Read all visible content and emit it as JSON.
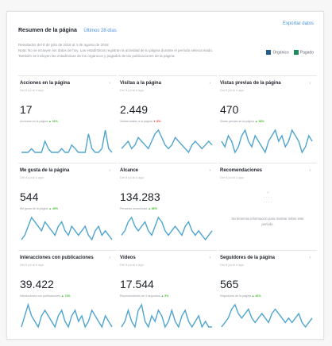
{
  "header": {
    "title": "Resumen de la página",
    "range_label": "Últimos 28 días",
    "export_label": "Exportar datos"
  },
  "meta_lines": [
    "Resultados del 8 de julio de 2018 al 4 de agosto de 2018",
    "Nota: No se incluyen los datos de hoy. Las estadísticas registran la actividad de tu página durante el período seleccionado.",
    "También se incluyen las estadísticas de los orgánicos y pagados de las publicaciones de la página."
  ],
  "legend": [
    {
      "label": "Orgánico",
      "color": "#1e5f8e"
    },
    {
      "label": "Pagado",
      "color": "#1f8b5f"
    }
  ],
  "colors": {
    "line": "#4fa5cf",
    "up": "#42b72a",
    "down": "#e63b3b",
    "link": "#4a90e2"
  },
  "cards": [
    {
      "title": "Acciones en la página",
      "subtitle": "Del 8 jul al 4 ago",
      "value": "17",
      "compare": "Acciones en la página",
      "pct": "▲ 31%",
      "trend": "up",
      "series": [
        2,
        2,
        2,
        3,
        2,
        2,
        2,
        5,
        3,
        2,
        2,
        2,
        3,
        2,
        2,
        4,
        3,
        2,
        2,
        2,
        7,
        3,
        2,
        2,
        3,
        8,
        3,
        2
      ]
    },
    {
      "title": "Visitas a la página",
      "subtitle": "Del 8 jul al 4 ago",
      "value": "2.449",
      "compare": "Visitas totales a la página",
      "pct": "▼ 8%",
      "trend": "down",
      "series": [
        4,
        5,
        6,
        4,
        5,
        7,
        6,
        5,
        4,
        6,
        8,
        9,
        7,
        5,
        4,
        5,
        7,
        6,
        5,
        4,
        3,
        5,
        6,
        5,
        4,
        5,
        6,
        5
      ]
    },
    {
      "title": "Vistas previas de la página",
      "subtitle": "Del 8 jul al 4 ago",
      "value": "470",
      "compare": "Vistas previas de la página",
      "pct": "▲ 36%",
      "trend": "up",
      "series": [
        5,
        4,
        6,
        5,
        3,
        4,
        6,
        7,
        5,
        4,
        6,
        5,
        4,
        3,
        5,
        6,
        7,
        5,
        6,
        4,
        5,
        7,
        6,
        5,
        3,
        4,
        6,
        5
      ]
    },
    {
      "title": "Me gusta de la página",
      "subtitle": "Del 8 jul al 4 ago",
      "value": "544",
      "compare": "Me gusta de la página",
      "pct": "▲ 49%",
      "trend": "up",
      "series": [
        3,
        4,
        6,
        8,
        7,
        6,
        5,
        7,
        6,
        5,
        4,
        6,
        7,
        5,
        4,
        6,
        5,
        4,
        5,
        6,
        4,
        3,
        5,
        6,
        4,
        5,
        4,
        3
      ]
    },
    {
      "title": "Alcance",
      "subtitle": "Del 8 jul al 4 ago",
      "value": "134.283",
      "compare": "Personas alcanzadas",
      "pct": "▲ 86%",
      "trend": "up",
      "series": [
        4,
        5,
        7,
        8,
        6,
        5,
        6,
        7,
        5,
        4,
        6,
        8,
        7,
        5,
        4,
        5,
        6,
        5,
        4,
        6,
        7,
        5,
        4,
        5,
        4,
        3,
        4,
        5
      ]
    },
    {
      "title": "Recomendaciones",
      "subtitle": "Del 8 jul al 4 ago",
      "value": "",
      "compare": "",
      "pct": "",
      "trend": "none",
      "empty_text": "No tenemos información para mostrar sobre este período.",
      "series": []
    },
    {
      "title": "Interacciones con publicaciones",
      "subtitle": "Del 8 jul al 4 ago",
      "value": "39.422",
      "compare": "Interacciones con publicaciones",
      "pct": "▲ 74%",
      "trend": "up",
      "series": [
        3,
        5,
        7,
        5,
        4,
        3,
        5,
        6,
        5,
        4,
        3,
        5,
        6,
        4,
        3,
        5,
        6,
        4,
        5,
        3,
        4,
        6,
        5,
        4,
        3,
        5,
        4,
        3
      ]
    },
    {
      "title": "Vídeos",
      "subtitle": "Del 8 jul al 4 ago",
      "value": "17.544",
      "compare": "Reproducciones de 3 segundos",
      "pct": "▲ 3%",
      "trend": "up",
      "series": [
        3,
        4,
        6,
        4,
        3,
        6,
        7,
        4,
        3,
        5,
        4,
        6,
        5,
        3,
        4,
        6,
        4,
        3,
        5,
        6,
        4,
        3,
        4,
        5,
        3,
        4,
        3,
        3
      ]
    },
    {
      "title": "Seguidores de la página",
      "subtitle": "Del 8 jul al 4 ago",
      "value": "565",
      "compare": "Seguidores de la página",
      "pct": "▲ 46%",
      "trend": "up",
      "series": [
        3,
        4,
        5,
        7,
        8,
        6,
        5,
        6,
        7,
        5,
        4,
        5,
        6,
        5,
        4,
        6,
        7,
        6,
        5,
        4,
        5,
        4,
        5,
        6,
        4,
        3,
        4,
        5
      ]
    }
  ]
}
